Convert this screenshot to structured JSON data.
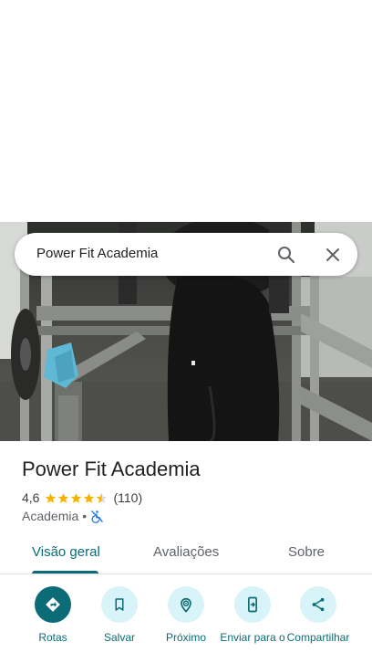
{
  "search": {
    "query": "Power Fit Academia",
    "search_icon": "search-icon",
    "close_icon": "close-icon"
  },
  "photo": {
    "description_icon": "gym-photo"
  },
  "place": {
    "title": "Power Fit Academia",
    "rating": "4,6",
    "rating_stars": 4.6,
    "review_count": "(110)",
    "category": "Academia",
    "separator": "•",
    "accessibility_icon": "not-wheelchair-accessible-icon"
  },
  "tabs": [
    {
      "label": "Visão geral",
      "active": true
    },
    {
      "label": "Avaliações",
      "active": false
    },
    {
      "label": "Sobre",
      "active": false
    }
  ],
  "actions": [
    {
      "label": "Rotas",
      "icon": "directions-icon"
    },
    {
      "label": "Salvar",
      "icon": "bookmark-icon"
    },
    {
      "label": "Próximo",
      "icon": "nearby-icon"
    },
    {
      "label": "Enviar para o",
      "icon": "send-to-phone-icon"
    },
    {
      "label": "Compartilhar",
      "icon": "share-icon"
    }
  ],
  "colors": {
    "accent": "#0b6b77",
    "action_bg": "#d9f4f8",
    "star": "#f4b400",
    "accessibility": "#1a73e8"
  }
}
